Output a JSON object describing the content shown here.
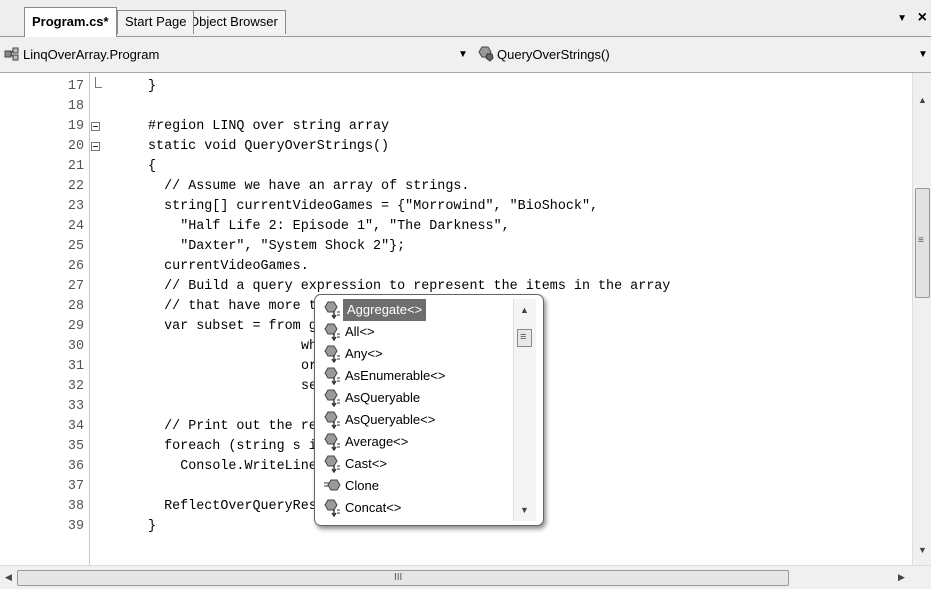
{
  "tabs": [
    {
      "label": "Program.cs*",
      "active": true
    },
    {
      "label": "Start Page",
      "active": false
    },
    {
      "label": "Object Browser",
      "active": false
    }
  ],
  "tab_controls": {
    "menu_glyph": "▼",
    "close_glyph": "×"
  },
  "navbar": {
    "type_combo": "LinqOverArray.Program",
    "member_combo": "QueryOverStrings()"
  },
  "code_lines": [
    {
      "num": "17",
      "text": "}",
      "indent": 0,
      "fold": "end"
    },
    {
      "num": "18",
      "text": "",
      "indent": 0,
      "fold": ""
    },
    {
      "num": "19",
      "text": "#region LINQ over string array",
      "indent": 0,
      "fold": "box"
    },
    {
      "num": "20",
      "text": "static void QueryOverStrings()",
      "indent": 0,
      "fold": "box"
    },
    {
      "num": "21",
      "text": "{",
      "indent": 0,
      "fold": ""
    },
    {
      "num": "22",
      "text": "// Assume we have an array of strings.",
      "indent": 2,
      "fold": ""
    },
    {
      "num": "23",
      "text": "string[] currentVideoGames = {\"Morrowind\", \"BioShock\",",
      "indent": 2,
      "fold": ""
    },
    {
      "num": "24",
      "text": "\"Half Life 2: Episode 1\", \"The Darkness\",",
      "indent": 4,
      "fold": ""
    },
    {
      "num": "25",
      "text": "\"Daxter\", \"System Shock 2\"};",
      "indent": 4,
      "fold": ""
    },
    {
      "num": "26",
      "text": "currentVideoGames.",
      "indent": 2,
      "fold": ""
    },
    {
      "num": "27",
      "text": "// Build a query expression to represent the items in the array",
      "indent": 2,
      "fold": ""
    },
    {
      "num": "28",
      "text": "// that have more than 6 letters.",
      "indent": 2,
      "fold": ""
    },
    {
      "num": "29",
      "text": "var subset = from g in currentVideoGames",
      "indent": 2,
      "fold": ""
    },
    {
      "num": "30",
      "text": "where g.Length > 6",
      "indent": 19,
      "fold": ""
    },
    {
      "num": "31",
      "text": "orderby g",
      "indent": 19,
      "fold": ""
    },
    {
      "num": "32",
      "text": "select g;",
      "indent": 19,
      "fold": ""
    },
    {
      "num": "33",
      "text": "",
      "indent": 0,
      "fold": ""
    },
    {
      "num": "34",
      "text": "// Print out the results.",
      "indent": 2,
      "fold": ""
    },
    {
      "num": "35",
      "text": "foreach (string s in subset)",
      "indent": 2,
      "fold": ""
    },
    {
      "num": "36",
      "text": "Console.WriteLine(\"Item: {0}\", s);",
      "indent": 4,
      "fold": ""
    },
    {
      "num": "37",
      "text": "",
      "indent": 0,
      "fold": ""
    },
    {
      "num": "38",
      "text": "ReflectOverQueryResults(subset);",
      "indent": 2,
      "fold": ""
    },
    {
      "num": "39",
      "text": "}",
      "indent": 0,
      "fold": ""
    }
  ],
  "intellisense": {
    "items": [
      {
        "label": "Aggregate<>",
        "icon": "extension-method-icon",
        "selected": true
      },
      {
        "label": "All<>",
        "icon": "extension-method-icon",
        "selected": false
      },
      {
        "label": "Any<>",
        "icon": "extension-method-icon",
        "selected": false
      },
      {
        "label": "AsEnumerable<>",
        "icon": "extension-method-icon",
        "selected": false
      },
      {
        "label": "AsQueryable",
        "icon": "extension-method-icon",
        "selected": false
      },
      {
        "label": "AsQueryable<>",
        "icon": "extension-method-icon",
        "selected": false
      },
      {
        "label": "Average<>",
        "icon": "extension-method-icon",
        "selected": false
      },
      {
        "label": "Cast<>",
        "icon": "extension-method-icon",
        "selected": false
      },
      {
        "label": "Clone",
        "icon": "method-icon",
        "selected": false
      },
      {
        "label": "Concat<>",
        "icon": "extension-method-icon",
        "selected": false
      }
    ]
  },
  "scrollbar": {
    "grip_glyph": "≡",
    "hgrip_glyph": "III"
  }
}
